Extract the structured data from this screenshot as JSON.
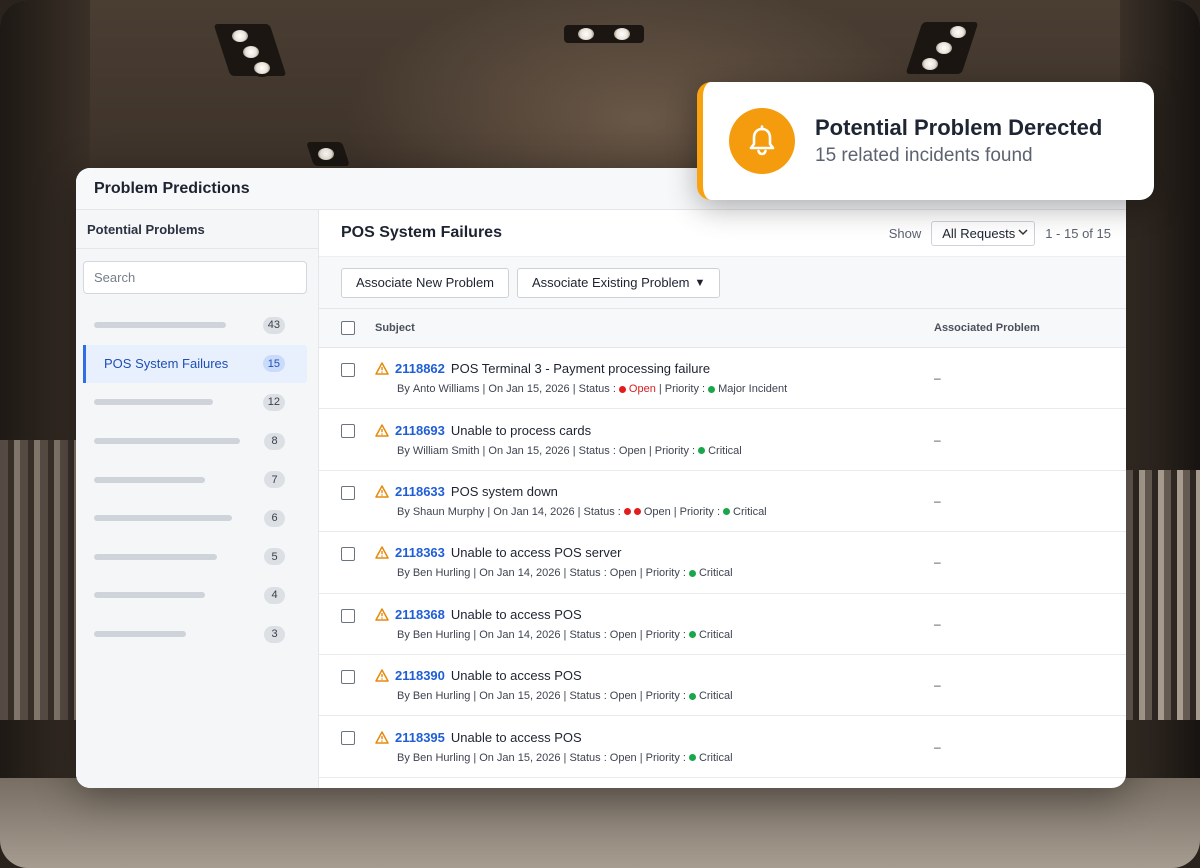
{
  "window": {
    "title": "Problem Predictions"
  },
  "sidebar": {
    "title": "Potential Problems",
    "search_placeholder": "Search",
    "items": [
      {
        "label": "",
        "count": "43",
        "active": false
      },
      {
        "label": "POS System Failures",
        "count": "15",
        "active": true
      },
      {
        "label": "",
        "count": "12",
        "active": false
      },
      {
        "label": "",
        "count": "8",
        "active": false
      },
      {
        "label": "",
        "count": "7",
        "active": false
      },
      {
        "label": "",
        "count": "6",
        "active": false
      },
      {
        "label": "",
        "count": "5",
        "active": false
      },
      {
        "label": "",
        "count": "4",
        "active": false
      },
      {
        "label": "",
        "count": "3",
        "active": false
      }
    ]
  },
  "main": {
    "title": "POS System Failures",
    "show_label": "Show",
    "filter_value": "All Requests",
    "pager": "1 - 15 of 15",
    "buttons": {
      "associate_new": "Associate New Problem",
      "associate_existing": "Associate Existing Problem",
      "caret": "▼"
    },
    "columns": {
      "subject": "Subject",
      "associated": "Associated Problem"
    },
    "rows": [
      {
        "id": "2118862",
        "subject": "POS Terminal 3 - Payment processing failure",
        "by": "By",
        "author": "Anto Williams",
        "on": "| On",
        "date": "Jan 15, 2026",
        "status_label": "| Status :",
        "status": "Open",
        "priority_label": "| Priority :",
        "priority": "Major Incident",
        "assoc": "–"
      },
      {
        "id": "2118693",
        "subject": "Unable to process cards",
        "by": "By",
        "author": "William Smith",
        "on": "| On",
        "date": "Jan 15, 2026",
        "status_label": "| Status :",
        "status": "Open",
        "priority_label": "| Priority :",
        "priority": "Critical",
        "assoc": "–"
      },
      {
        "id": "2118633",
        "subject": "POS system down",
        "by": "By",
        "author": "Shaun Murphy",
        "on": "| On",
        "date": "Jan 14, 2026",
        "status_label": "| Status :",
        "status": "Open",
        "priority_label": "| Priority :",
        "priority": "Critical",
        "assoc": "–"
      },
      {
        "id": "2118363",
        "subject": "Unable to access POS server",
        "by": "By",
        "author": "Ben Hurling",
        "on": "| On",
        "date": "Jan 14, 2026",
        "status_label": "| Status :",
        "status": "Open",
        "priority_label": "| Priority :",
        "priority": "Critical",
        "assoc": "–"
      },
      {
        "id": "2118368",
        "subject": "Unable to access POS",
        "by": "By",
        "author": "Ben Hurling",
        "on": "| On",
        "date": "Jan 14, 2026",
        "status_label": "| Status :",
        "status": "Open",
        "priority_label": "| Priority :",
        "priority": "Critical",
        "assoc": "–"
      },
      {
        "id": "2118390",
        "subject": "Unable to access POS",
        "by": "By",
        "author": "Ben Hurling",
        "on": "| On",
        "date": "Jan 15, 2026",
        "status_label": "| Status :",
        "status": "Open",
        "priority_label": "| Priority :",
        "priority": "Critical",
        "assoc": "–"
      },
      {
        "id": "2118395",
        "subject": "Unable to access POS",
        "by": "By",
        "author": "Ben Hurling",
        "on": "| On",
        "date": "Jan 15, 2026",
        "status_label": "| Status :",
        "status": "Open",
        "priority_label": "| Priority :",
        "priority": "Critical",
        "assoc": "–"
      }
    ]
  },
  "notification": {
    "title": "Potential Problem Derected",
    "subtitle": "15 related incidents found",
    "icon": "bell-icon"
  },
  "colors": {
    "accent": "#1f5ed6",
    "notify_orange": "#f59c0e",
    "status_red": "#e11d1d",
    "priority_green": "#1aa64a"
  }
}
